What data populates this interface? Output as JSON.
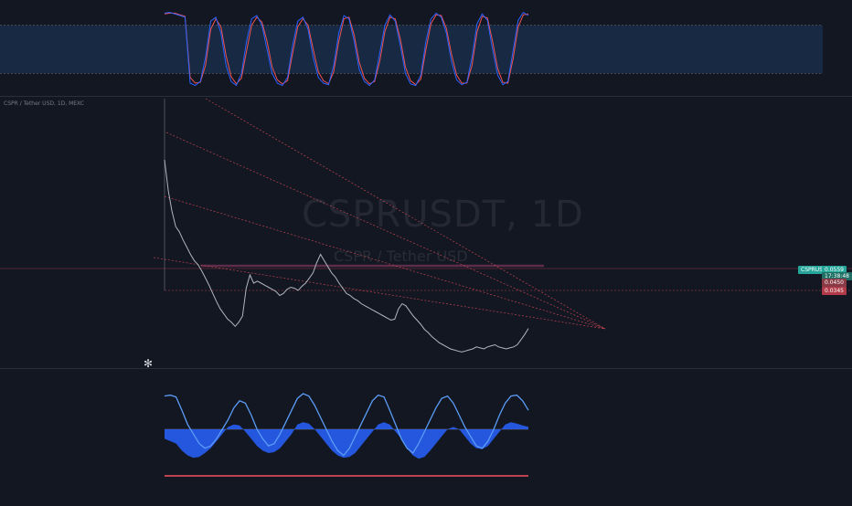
{
  "watermark": {
    "symbol": "CSPRUSDT, 1D",
    "name": "CSPR / Tether USD"
  },
  "symbol_line": "CSPR / Tether USD, 1D, MEXC",
  "badges": {
    "symbol": "CSPRUSDT",
    "price": "0.0559",
    "countdown": "17:38:48",
    "level_a": "0.0450",
    "level_b": "0.0345"
  },
  "colors": {
    "background": "#131722",
    "price_line": "#b2b5be",
    "stoch_k": "#2962ff",
    "stoch_d": "#ef5350",
    "stoch_band": "#1e3a5f",
    "trendline": "#f7525f",
    "hist_area": "#2962ff",
    "lower_line": "#5b9cf6",
    "green": "#26a69a",
    "yellow": "#f7c948"
  },
  "logo_icon": "tradingview-logo-icon",
  "chart_data": [
    {
      "type": "line",
      "pane": "stochastic-oscillator",
      "ylim": [
        0,
        100
      ],
      "band": [
        20,
        80
      ],
      "series": [
        {
          "values": [
            95,
            96,
            94,
            92,
            90,
            8,
            5,
            10,
            40,
            85,
            90,
            70,
            30,
            10,
            5,
            20,
            60,
            88,
            92,
            80,
            50,
            20,
            8,
            5,
            15,
            55,
            85,
            90,
            75,
            40,
            15,
            8,
            6,
            30,
            70,
            92,
            88,
            60,
            25,
            10,
            5,
            12,
            45,
            80,
            93,
            85,
            55,
            20,
            7,
            5,
            18,
            60,
            88,
            95,
            90,
            70,
            35,
            12,
            6,
            9,
            40,
            82,
            94,
            86,
            50,
            18,
            6,
            10,
            48,
            86,
            96,
            92
          ]
        },
        {
          "values": [
            94,
            95,
            95,
            93,
            91,
            15,
            8,
            9,
            30,
            75,
            88,
            78,
            42,
            16,
            7,
            14,
            48,
            80,
            90,
            84,
            60,
            28,
            12,
            7,
            11,
            45,
            78,
            88,
            80,
            50,
            22,
            11,
            7,
            22,
            60,
            88,
            90,
            68,
            34,
            14,
            7,
            10,
            35,
            72,
            90,
            88,
            63,
            28,
            11,
            6,
            13,
            50,
            82,
            93,
            92,
            76,
            44,
            18,
            8,
            8,
            30,
            72,
            91,
            89,
            60,
            26,
            9,
            8,
            38,
            78,
            93,
            94
          ]
        }
      ]
    },
    {
      "type": "line",
      "pane": "price",
      "title": "CSPRUSDT, 1D",
      "ylim": [
        0.02,
        0.26
      ],
      "series": [
        {
          "values": [
            0.22,
            0.19,
            0.17,
            0.155,
            0.15,
            0.142,
            0.135,
            0.128,
            0.122,
            0.118,
            0.112,
            0.105,
            0.098,
            0.09,
            0.082,
            0.075,
            0.07,
            0.065,
            0.062,
            0.058,
            0.062,
            0.068,
            0.095,
            0.108,
            0.1,
            0.102,
            0.1,
            0.098,
            0.096,
            0.094,
            0.092,
            0.088,
            0.09,
            0.094,
            0.096,
            0.095,
            0.093,
            0.097,
            0.1,
            0.105,
            0.11,
            0.12,
            0.128,
            0.122,
            0.116,
            0.11,
            0.106,
            0.1,
            0.095,
            0.09,
            0.088,
            0.085,
            0.083,
            0.08,
            0.078,
            0.076,
            0.074,
            0.072,
            0.07,
            0.068,
            0.066,
            0.064,
            0.065,
            0.075,
            0.08,
            0.078,
            0.073,
            0.068,
            0.064,
            0.06,
            0.055,
            0.052,
            0.048,
            0.045,
            0.042,
            0.04,
            0.038,
            0.036,
            0.035,
            0.034,
            0.033,
            0.034,
            0.035,
            0.036,
            0.038,
            0.037,
            0.036,
            0.038,
            0.039,
            0.04,
            0.038,
            0.037,
            0.036,
            0.037,
            0.038,
            0.04,
            0.045,
            0.05,
            0.0559
          ]
        }
      ]
    },
    {
      "type": "area",
      "pane": "lower-indicator",
      "ylim": [
        -100,
        100
      ],
      "series": [
        {
          "values": [
            70,
            72,
            68,
            40,
            10,
            -10,
            -30,
            -40,
            -35,
            -20,
            0,
            20,
            45,
            60,
            55,
            30,
            0,
            -20,
            -35,
            -30,
            -10,
            15,
            40,
            65,
            75,
            70,
            50,
            25,
            0,
            -25,
            -45,
            -55,
            -40,
            -15,
            10,
            35,
            60,
            72,
            68,
            40,
            10,
            -20,
            -40,
            -50,
            -30,
            -5,
            20,
            45,
            65,
            70,
            55,
            30,
            5,
            -15,
            -35,
            -40,
            -25,
            0,
            30,
            55,
            70,
            72,
            60,
            40
          ]
        },
        {
          "values": [
            -20,
            -25,
            -30,
            -45,
            -55,
            -60,
            -58,
            -50,
            -40,
            -25,
            -10,
            5,
            10,
            8,
            -5,
            -20,
            -35,
            -45,
            -50,
            -48,
            -40,
            -25,
            -10,
            10,
            15,
            12,
            0,
            -15,
            -30,
            -45,
            -55,
            -60,
            -58,
            -50,
            -35,
            -20,
            -5,
            10,
            15,
            10,
            -5,
            -20,
            -40,
            -55,
            -62,
            -58,
            -45,
            -30,
            -15,
            0,
            5,
            0,
            -15,
            -30,
            -40,
            -42,
            -35,
            -20,
            -5,
            10,
            15,
            12,
            8,
            5
          ]
        }
      ]
    }
  ]
}
